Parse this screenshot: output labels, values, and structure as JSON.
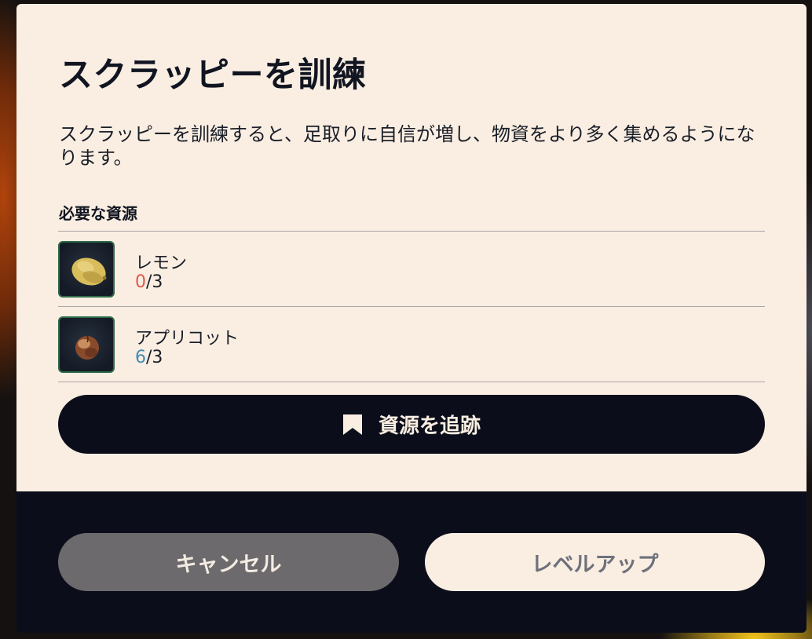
{
  "dialog": {
    "title": "スクラッピーを訓練",
    "description": "スクラッピーを訓練すると、足取りに自信が増し、物資をより多く集めるようになります。",
    "section_label": "必要な資源"
  },
  "resources": [
    {
      "name": "レモン",
      "have": "0",
      "need": "/3",
      "icon": "lemon-icon",
      "have_color": "#e2584a"
    },
    {
      "name": "アプリコット",
      "have": "6",
      "need": "/3",
      "icon": "apricot-icon",
      "have_color": "#3f8db5"
    }
  ],
  "track_button": {
    "label": "資源を追跡",
    "icon": "bookmark-icon"
  },
  "footer": {
    "cancel_label": "キャンセル",
    "levelup_label": "レベルアップ"
  },
  "colors": {
    "panel_bg": "#faeee2",
    "footer_bg": "#0b0e1a",
    "insufficient": "#e2584a",
    "sufficient": "#3f8db5",
    "icon_border": "#2f6a48"
  }
}
